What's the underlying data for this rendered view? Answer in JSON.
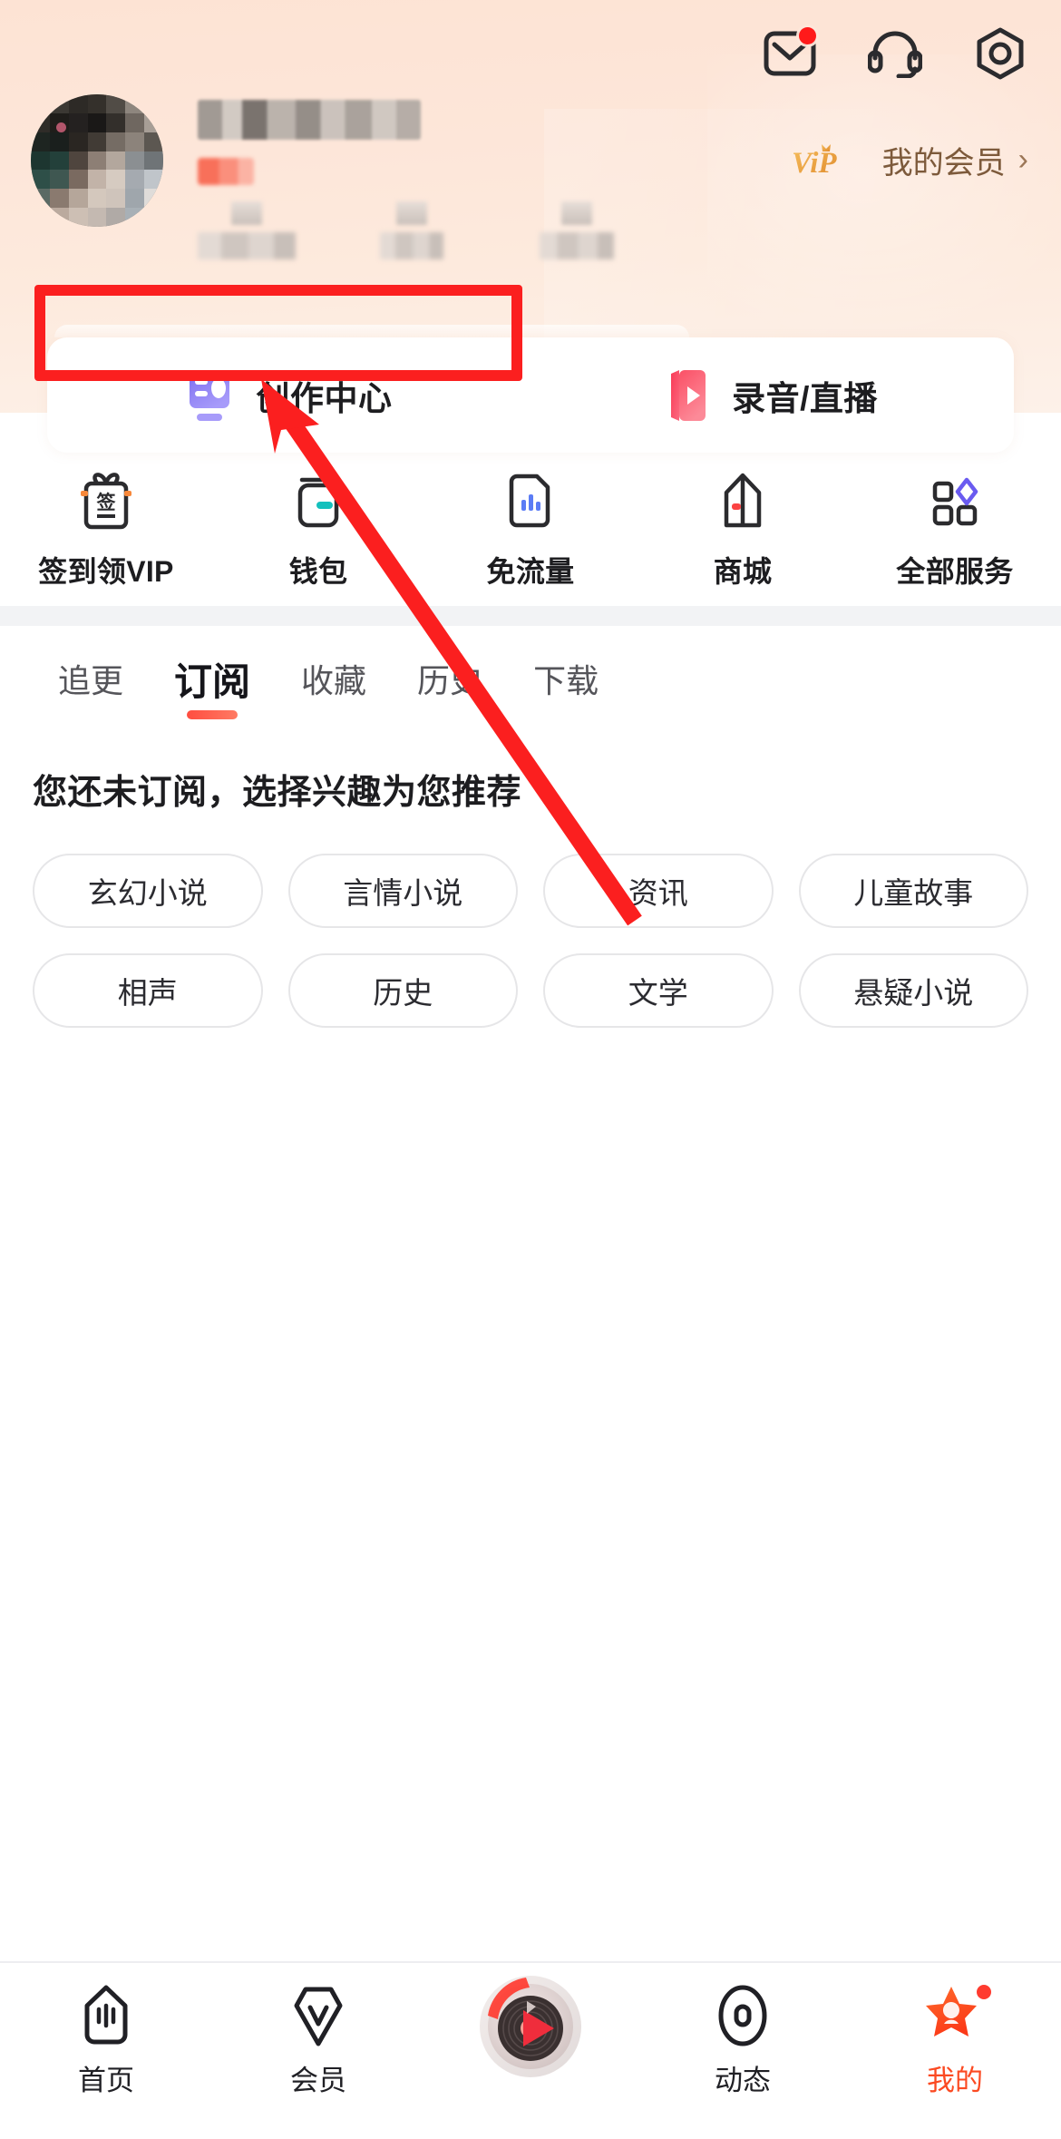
{
  "header": {
    "top_icons": [
      {
        "name": "mail-icon",
        "label": "消息",
        "has_badge": true
      },
      {
        "name": "headset-icon",
        "label": "客服",
        "has_badge": false
      },
      {
        "name": "settings-icon",
        "label": "设置",
        "has_badge": false
      }
    ],
    "vip": {
      "logo_text": "ViP",
      "label": "我的会员",
      "chevron": "›",
      "color": "#e8a14a"
    },
    "profile": {
      "username_redacted": true,
      "badge_redacted": true,
      "stats_redacted": true,
      "stats_count": 3
    }
  },
  "entry_card": {
    "items": [
      {
        "icon": "creation-center-icon",
        "label": "创作中心",
        "highlighted": true
      },
      {
        "icon": "record-live-icon",
        "label": "录音/直播",
        "highlighted": false
      }
    ]
  },
  "services": {
    "items": [
      {
        "icon": "sign-in-gift-icon",
        "label": "签到领VIP"
      },
      {
        "icon": "wallet-icon",
        "label": "钱包"
      },
      {
        "icon": "free-data-icon",
        "label": "免流量"
      },
      {
        "icon": "shop-icon",
        "label": "商城"
      },
      {
        "icon": "all-services-icon",
        "label": "全部服务"
      }
    ]
  },
  "tabs": {
    "items": [
      {
        "label": "追更",
        "active": false
      },
      {
        "label": "订阅",
        "active": true
      },
      {
        "label": "收藏",
        "active": false
      },
      {
        "label": "历史",
        "active": false
      },
      {
        "label": "下载",
        "active": false
      }
    ],
    "active_color": "#ff4d40"
  },
  "subscribe": {
    "empty_title": "您还未订阅，选择兴趣为您推荐",
    "interest_tags": [
      "玄幻小说",
      "言情小说",
      "资讯",
      "儿童故事",
      "相声",
      "历史",
      "文学",
      "悬疑小说"
    ]
  },
  "bottom_nav": {
    "items": [
      {
        "icon": "home-icon",
        "label": "首页",
        "active": false,
        "has_badge": false
      },
      {
        "icon": "vip-member-icon",
        "label": "会员",
        "active": false,
        "has_badge": false
      },
      {
        "icon": "play-disc-icon",
        "label": "",
        "active": false,
        "has_badge": false
      },
      {
        "icon": "dynamic-icon",
        "label": "动态",
        "active": false,
        "has_badge": false
      },
      {
        "icon": "profile-star-icon",
        "label": "我的",
        "active": true,
        "has_badge": true
      }
    ],
    "active_color": "#fb4a22"
  },
  "annotation": {
    "color": "#fb1f1f",
    "target": "创作中心",
    "type": "rectangle-with-arrow"
  }
}
